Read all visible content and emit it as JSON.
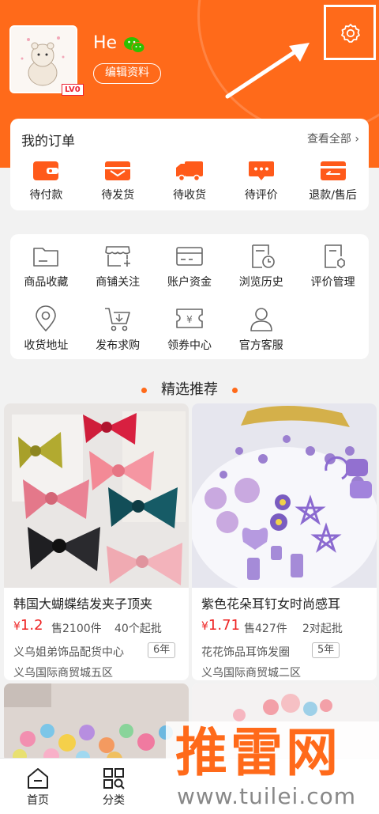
{
  "profile": {
    "username": "He",
    "level": "LV0",
    "edit_label": "编辑资料"
  },
  "orders": {
    "title": "我的订单",
    "view_all": "查看全部",
    "items": [
      {
        "label": "待付款",
        "icon": "wallet-icon"
      },
      {
        "label": "待发货",
        "icon": "box-icon"
      },
      {
        "label": "待收货",
        "icon": "truck-icon"
      },
      {
        "label": "待评价",
        "icon": "chat-icon"
      },
      {
        "label": "退款/售后",
        "icon": "refund-icon"
      }
    ]
  },
  "tools": {
    "items": [
      {
        "label": "商品收藏",
        "icon": "folder-icon"
      },
      {
        "label": "商铺关注",
        "icon": "store-follow-icon"
      },
      {
        "label": "账户资金",
        "icon": "card-icon"
      },
      {
        "label": "浏览历史",
        "icon": "history-icon"
      },
      {
        "label": "评价管理",
        "icon": "review-manage-icon"
      },
      {
        "label": "收货地址",
        "icon": "location-icon"
      },
      {
        "label": "发布求购",
        "icon": "cart-icon"
      },
      {
        "label": "领券中心",
        "icon": "coupon-icon"
      },
      {
        "label": "官方客服",
        "icon": "customer-service-icon"
      }
    ]
  },
  "recommend": {
    "title": "精选推荐",
    "products": [
      {
        "title": "韩国大蝴蝶结发夹子顶夹",
        "currency": "¥",
        "price": "1.2",
        "sold": "售2100件",
        "min_order": "40个起批",
        "shop": "义乌姐弟饰品配货中心",
        "years": "6年",
        "market": "义乌国际商贸城五区"
      },
      {
        "title": "紫色花朵耳钉女时尚感耳",
        "currency": "¥",
        "price": "1.71",
        "sold": "售427件",
        "min_order": "2对起批",
        "shop": "花花饰品耳饰发圈",
        "years": "5年",
        "market": "义乌国际商贸城二区"
      }
    ]
  },
  "nav": {
    "home": "首页",
    "category": "分类"
  },
  "watermark": {
    "text": "推雷网",
    "url": "www.tuilei.com"
  },
  "colors": {
    "brand": "#ff6a1a",
    "price": "#e22222"
  }
}
